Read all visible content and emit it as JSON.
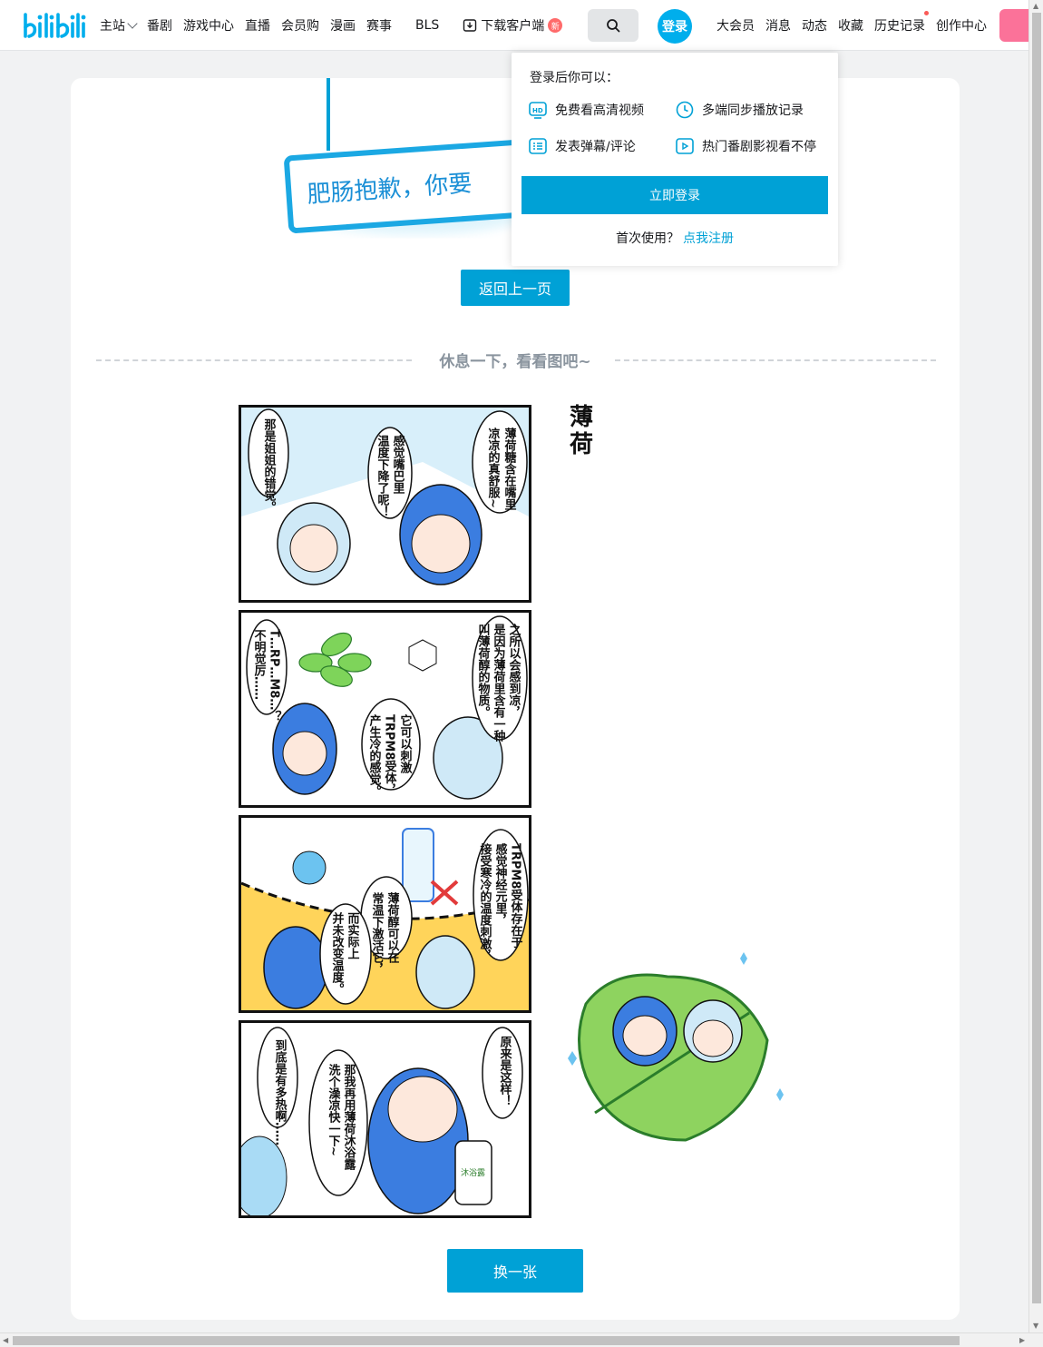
{
  "header": {
    "nav_left": [
      {
        "label": "主站",
        "has_dropdown": true
      },
      {
        "label": "番剧"
      },
      {
        "label": "游戏中心"
      },
      {
        "label": "直播"
      },
      {
        "label": "会员购"
      },
      {
        "label": "漫画"
      },
      {
        "label": "赛事"
      },
      {
        "label": "BLS"
      },
      {
        "label": "下载客户端",
        "badge": "新"
      }
    ],
    "login_label": "登录",
    "nav_right": [
      {
        "label": "大会员"
      },
      {
        "label": "消息"
      },
      {
        "label": "动态"
      },
      {
        "label": "收藏"
      },
      {
        "label": "历史记录"
      },
      {
        "label": "创作中心"
      }
    ]
  },
  "login_popover": {
    "title": "登录后你可以：",
    "features": [
      "免费看高清视频",
      "多端同步播放记录",
      "发表弹幕/评论",
      "热门番剧影视看不停"
    ],
    "login_button": "立即登录",
    "first_use": "首次使用？",
    "register_link": "点我注册"
  },
  "error_page": {
    "sorry_text": "肥肠抱歉，你要",
    "back_button": "返回上一页",
    "rest_text": "休息一下，看看图吧~",
    "change_button": "换一张"
  },
  "comic": {
    "title": "薄荷",
    "panels": [
      {
        "bubbles": [
          "薄荷糖含在嘴里",
          "凉凉的真舒服~",
          "感觉嘴巴里",
          "温度下降了呢！",
          "那是姐姐的错觉。"
        ]
      },
      {
        "bubbles": [
          "之所以会感到凉，",
          "是因为薄荷里含有一种",
          "叫薄荷醇的物质。",
          "它可以刺激",
          "TRPM8受体，",
          "产生冷的感觉。",
          "T…RP…M8…？",
          "不明觉厉……"
        ]
      },
      {
        "bubbles": [
          "TRPM8受体存在于",
          "感觉神经元里，",
          "接受寒冷的温度刺激，",
          "薄荷醇可以在",
          "常温下激活它，",
          "而实际上",
          "并未改变温度。"
        ]
      },
      {
        "bubbles": [
          "原来是这样！",
          "那我再用薄荷沐浴露",
          "洗个澡凉快一下~",
          "到底是有多热啊……"
        ]
      }
    ],
    "bottle_label": "沐浴露"
  },
  "colors": {
    "brand_blue": "#00a1d6",
    "brand_pink": "#fb7299",
    "logo_blue": "#00aeec"
  }
}
